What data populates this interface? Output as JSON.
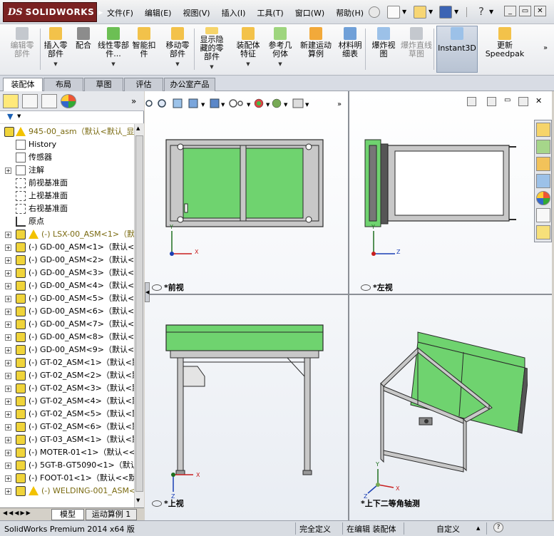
{
  "app": {
    "logo_ds": "DS",
    "logo_name": "SOLIDWORKS"
  },
  "menu": [
    "文件(F)",
    "编辑(E)",
    "视图(V)",
    "插入(I)",
    "工具(T)",
    "窗口(W)",
    "帮助(H)"
  ],
  "ribbon": {
    "buttons": [
      {
        "label": "编辑零部件",
        "disabled": true
      },
      {
        "label": "插入零部件",
        "disabled": false
      },
      {
        "label": "配合",
        "disabled": false
      },
      {
        "label": "线性零部件...",
        "disabled": false
      },
      {
        "label": "智能扣件",
        "disabled": false
      },
      {
        "label": "移动零部件",
        "disabled": false
      },
      {
        "label": "显示隐藏的零部件",
        "disabled": false
      },
      {
        "label": "装配体特征",
        "disabled": false
      },
      {
        "label": "参考几何体",
        "disabled": false
      },
      {
        "label": "新建运动算例",
        "disabled": false
      },
      {
        "label": "材料明细表",
        "disabled": false
      },
      {
        "label": "爆炸视图",
        "disabled": false
      },
      {
        "label": "爆炸直线草图",
        "disabled": true
      },
      {
        "label": "Instant3D",
        "disabled": false
      },
      {
        "label": "更新Speedpak",
        "disabled": false
      }
    ]
  },
  "tabs": [
    "装配体",
    "布局",
    "草图",
    "评估",
    "办公室产品"
  ],
  "tree": {
    "root": "945-00_asm（默认<默认_显",
    "items": [
      {
        "label": "History",
        "type": "history"
      },
      {
        "label": "传感器",
        "type": "sensor"
      },
      {
        "label": "注解",
        "type": "annot"
      },
      {
        "label": "前视基准面",
        "type": "plane"
      },
      {
        "label": "上视基准面",
        "type": "plane"
      },
      {
        "label": "右视基准面",
        "type": "plane"
      },
      {
        "label": "原点",
        "type": "origin"
      },
      {
        "label": "(-) LSX-00_ASM<1>（默认",
        "type": "warn"
      },
      {
        "label": "(-) GD-00_ASM<1>（默认<默",
        "type": "asm"
      },
      {
        "label": "(-) GD-00_ASM<2>（默认<默",
        "type": "asm"
      },
      {
        "label": "(-) GD-00_ASM<3>（默认<默",
        "type": "asm"
      },
      {
        "label": "(-) GD-00_ASM<4>（默认<默",
        "type": "asm"
      },
      {
        "label": "(-) GD-00_ASM<5>（默认<默",
        "type": "asm"
      },
      {
        "label": "(-) GD-00_ASM<6>（默认<默",
        "type": "asm"
      },
      {
        "label": "(-) GD-00_ASM<7>（默认<默",
        "type": "asm"
      },
      {
        "label": "(-) GD-00_ASM<8>（默认<默",
        "type": "asm"
      },
      {
        "label": "(-) GD-00_ASM<9>（默认<默",
        "type": "asm"
      },
      {
        "label": "(-) GT-02_ASM<1>（默认<默",
        "type": "asm"
      },
      {
        "label": "(-) GT-02_ASM<2>（默认<默",
        "type": "asm"
      },
      {
        "label": "(-) GT-02_ASM<3>（默认<默",
        "type": "asm"
      },
      {
        "label": "(-) GT-02_ASM<4>（默认<默",
        "type": "asm"
      },
      {
        "label": "(-) GT-02_ASM<5>（默认<默",
        "type": "asm"
      },
      {
        "label": "(-) GT-02_ASM<6>（默认<默",
        "type": "asm"
      },
      {
        "label": "(-) GT-03_ASM<1>（默认<默",
        "type": "asm"
      },
      {
        "label": "(-) MOTER-01<1>（默认<<默",
        "type": "asm"
      },
      {
        "label": "(-) 5GT-B-GT5090<1>（默认<",
        "type": "asm"
      },
      {
        "label": "(-) FOOT-01<1>（默认<<默",
        "type": "asm"
      },
      {
        "label": "(-) WELDING-001_ASM<1>",
        "type": "warn"
      }
    ]
  },
  "bottom_tabs": [
    "模型",
    "运动算例 1"
  ],
  "views": {
    "front": "*前视",
    "left": "*左视",
    "top": "*上视",
    "iso": "*上下二等角轴测"
  },
  "axes": {
    "x": "X",
    "y": "Y",
    "z": "Z"
  },
  "status": {
    "product": "SolidWorks Premium 2014 x64 版",
    "defined": "完全定义",
    "editing": "在编辑 装配体",
    "units": "自定义"
  },
  "colors": {
    "panel_green": "#6fd36f",
    "frame_grey": "#c8c8c8",
    "edge": "#2a2a2a",
    "logo_red": "#7a2222",
    "warn_yellow": "#f2c200"
  }
}
